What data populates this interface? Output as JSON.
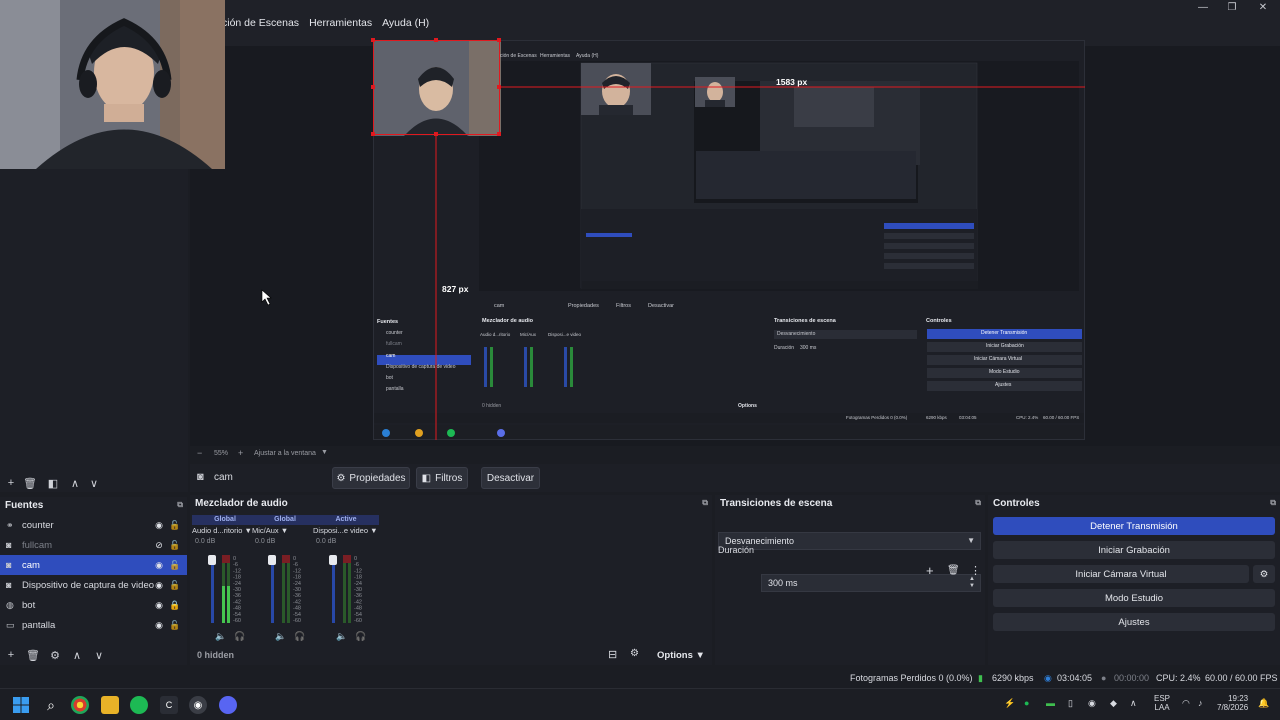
{
  "menu": [
    "ción de Escenas",
    "Herramientas",
    "Ayuda (H)"
  ],
  "window_controls": [
    "minimize",
    "maximize",
    "close"
  ],
  "preview": {
    "nested_menu": [
      "ción de Escenas",
      "Herramientas",
      "Ayuda (H)"
    ],
    "measure_h": "1583 px",
    "measure_v": "827 px",
    "nested_source_name": "cam",
    "nested_props": "Propiedades",
    "nested_filters": "Filtros",
    "nested_deactivate": "Desactivar",
    "nested_fuentes": "Fuentes",
    "nested_sources": [
      "counter",
      "fullcam",
      "cam",
      "Dispositivo de captura de video",
      "bot",
      "pantalla"
    ],
    "nested_mixer": "Mezclador de audio",
    "nested_mixer_names": [
      "Audio d...ritorio",
      "Mic/Aux",
      "Disposi...e video"
    ],
    "nested_hidden": "0 hidden",
    "nested_options": "Options",
    "nested_transitions": "Transiciones de escena",
    "nested_transition_value": "Desvanecimiento",
    "nested_duration_label": "Duración",
    "nested_duration_value": "300 ms",
    "nested_controls": "Controles",
    "nested_ctrl": [
      "Detener Transmisión",
      "Iniciar Grabación",
      "Iniciar Cámara Virtual",
      "Modo Estudio",
      "Ajustes"
    ],
    "nested_status": "Fotogramas Perdidos 0 (0.0%)",
    "nested_kbps": "6290 kbps",
    "nested_time": "03:04:05",
    "nested_cpu": "CPU: 2.4%",
    "nested_fps": "60.00 / 60.00 FPS",
    "nested_zoom": "55%",
    "nested_fit": "Ajustar a la ventana"
  },
  "zoom": {
    "minus": "−",
    "value": "55%",
    "plus": "+",
    "fit": "Ajustar a la ventana"
  },
  "context": {
    "source_name": "cam",
    "properties": "Propiedades",
    "filters": "Filtros",
    "deactivate": "Desactivar"
  },
  "sources": {
    "title": "Fuentes",
    "items": [
      {
        "label": "counter",
        "icon": "link-icon",
        "visible": true,
        "locked": false
      },
      {
        "label": "fullcam",
        "icon": "camera-icon",
        "visible": false,
        "locked": false
      },
      {
        "label": "cam",
        "icon": "camera-icon",
        "visible": true,
        "locked": false,
        "selected": true
      },
      {
        "label": "Dispositivo de captura de video",
        "icon": "camera-icon",
        "visible": true,
        "locked": false
      },
      {
        "label": "bot",
        "icon": "globe-icon",
        "visible": true,
        "locked": true
      },
      {
        "label": "pantalla",
        "icon": "monitor-icon",
        "visible": true,
        "locked": false
      }
    ]
  },
  "mixer": {
    "title": "Mezclador de audio",
    "channels": [
      {
        "global": "Global",
        "name": "Audio d...ritorio",
        "db": "0.0 dB",
        "level": 0.55
      },
      {
        "global": "Global",
        "name": "Mic/Aux",
        "db": "0.0 dB",
        "level": 0.0
      },
      {
        "global": "Active",
        "name": "Disposi...e video",
        "db": "0.0 dB",
        "level": 0.0
      }
    ],
    "scale": [
      "0",
      "-6",
      "-12",
      "-18",
      "-24",
      "-30",
      "-36",
      "-42",
      "-48",
      "-54",
      "-60"
    ],
    "hidden": "0 hidden",
    "options": "Options"
  },
  "transitions": {
    "title": "Transiciones de escena",
    "value": "Desvanecimiento",
    "duration_label": "Duración",
    "duration_value": "300 ms"
  },
  "controls": {
    "title": "Controles",
    "stop_stream": "Detener Transmisión",
    "start_recording": "Iniciar Grabación",
    "start_virtual_cam": "Iniciar Cámara Virtual",
    "studio_mode": "Modo Estudio",
    "settings": "Ajustes"
  },
  "status": {
    "dropped": "Fotogramas Perdidos 0 (0.0%)",
    "kbps": "6290 kbps",
    "stream_time": "03:04:05",
    "rec_time": "00:00:00",
    "cpu": "CPU: 2.4%",
    "fps": "60.00 / 60.00 FPS"
  },
  "taskbar": {
    "lang": "ESP",
    "lang2": "LAA",
    "time": "19:23",
    "date": "7/8/2026"
  },
  "colors": {
    "accent": "#2f4dbd",
    "guide": "#e0191f",
    "panel": "#1d1f26"
  }
}
